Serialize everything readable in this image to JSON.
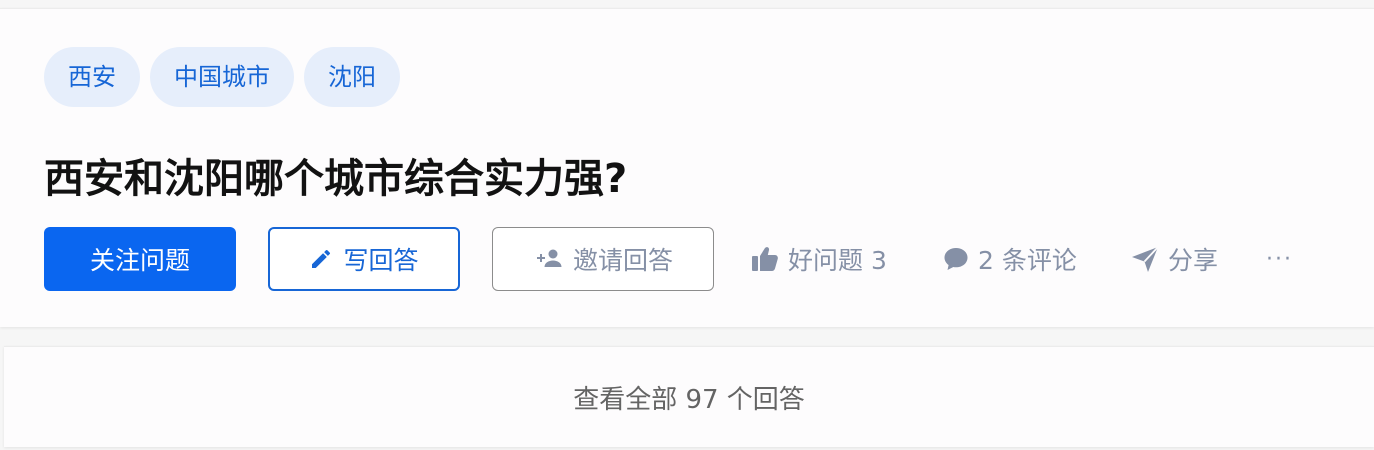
{
  "question": {
    "topics": [
      "西安",
      "中国城市",
      "沈阳"
    ],
    "title": "西安和沈阳哪个城市综合实力强?"
  },
  "actions": {
    "follow_label": "关注问题",
    "write_label": "写回答",
    "invite_label": "邀请回答",
    "like_label": "好问题 3",
    "comment_label": "2 条评论",
    "share_label": "分享",
    "more_label": "···"
  },
  "answers": {
    "view_all_label": "查看全部 97 个回答"
  },
  "icons": {
    "write": "pencil-icon",
    "invite": "add-person-icon",
    "like": "thumbs-up-icon",
    "comment": "speech-bubble-icon",
    "share": "paper-plane-icon"
  },
  "colors": {
    "accent": "#0a66f0",
    "topic_bg": "#e6eefb",
    "topic_text": "#1766d6",
    "meta_text": "#8590a6"
  }
}
